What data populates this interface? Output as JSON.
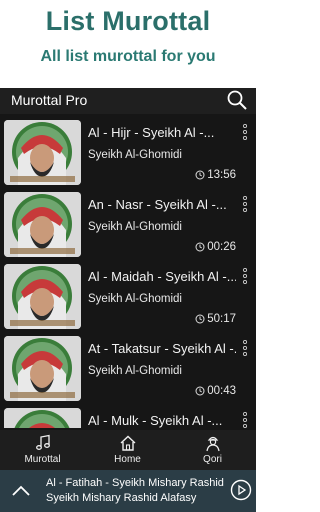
{
  "promo": {
    "title": "List Murottal",
    "subtitle": "All list murottal for you"
  },
  "appbar": {
    "title": "Murottal Pro",
    "search_icon": "search-icon"
  },
  "list": {
    "items": [
      {
        "title": "Al - Hijr - Syeikh Al -...",
        "artist": "Syeikh Al-Ghomidi",
        "duration": "13:56"
      },
      {
        "title": "An - Nasr - Syeikh Al -...",
        "artist": "Syeikh Al-Ghomidi",
        "duration": "00:26"
      },
      {
        "title": "Al - Maidah - Syeikh Al -...",
        "artist": "Syeikh Al-Ghomidi",
        "duration": "50:17"
      },
      {
        "title": "At - Takatsur - Syeikh Al -...",
        "artist": "Syeikh Al-Ghomidi",
        "duration": "00:43"
      },
      {
        "title": "Al - Mulk - Syeikh Al -...",
        "artist": "",
        "duration": ""
      }
    ]
  },
  "bottomnav": {
    "items": [
      {
        "label": "Murottal",
        "icon": "music-note-icon"
      },
      {
        "label": "Home",
        "icon": "home-icon"
      },
      {
        "label": "Qori",
        "icon": "person-icon"
      }
    ]
  },
  "player": {
    "title": "Al - Fatihah - Syeikh Mishary Rashid",
    "artist": "Syeikh Mishary Rashid Alafasy"
  },
  "colors": {
    "promo_text": "#2b6f6a",
    "background": "#161616",
    "player_bar": "#2b3d46"
  }
}
